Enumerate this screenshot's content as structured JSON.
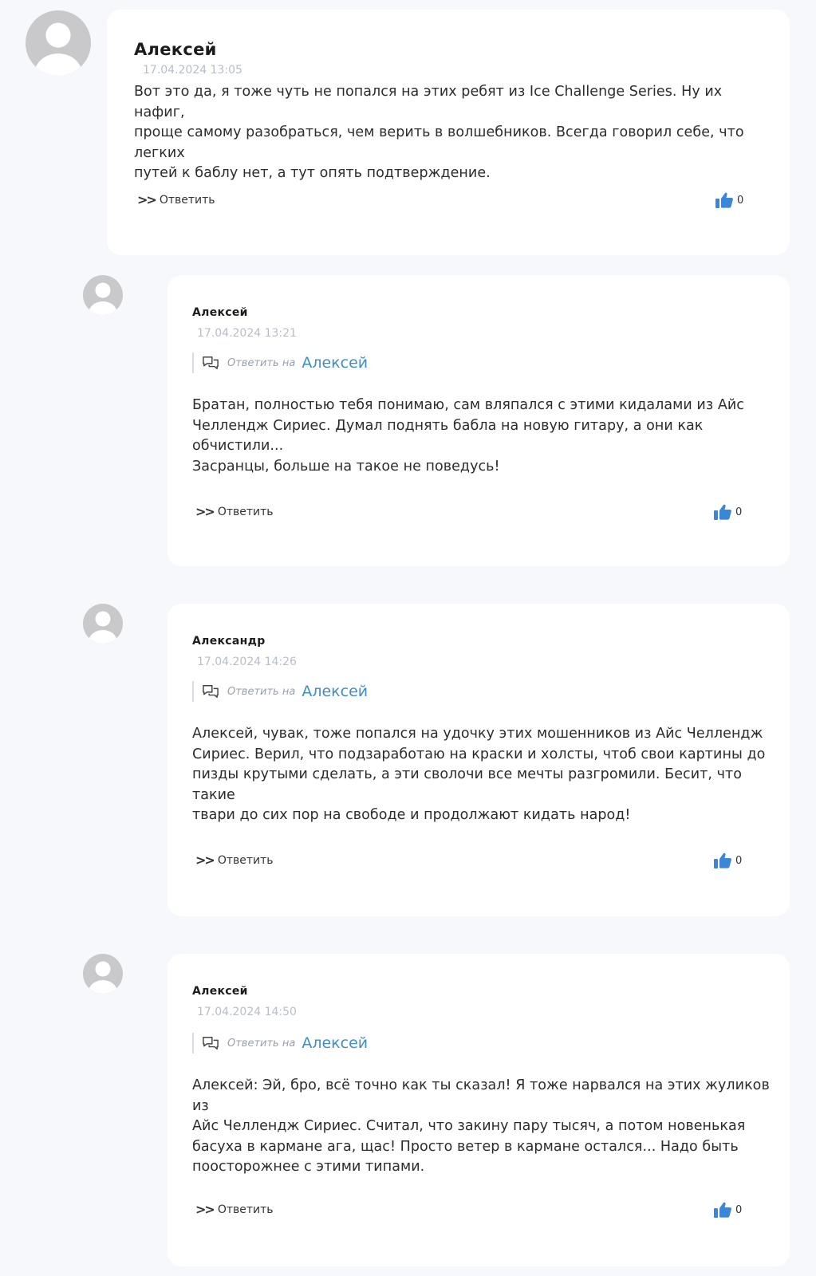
{
  "comments": [
    {
      "author": "Алексей",
      "date": "17.04.2024 13:05",
      "text_lines": [
        "Вот это да, я тоже чуть не попался на этих ребят из Ice Challenge Series. Ну их нафиг,",
        "проще самому разобраться, чем верить в волшебников. Всегда говорил себе, что легких",
        "путей к баблу нет, а тут опять подтверждение."
      ],
      "reply_label": "Ответить",
      "likes": "0"
    },
    {
      "author": "Алексей",
      "date": "17.04.2024 13:21",
      "reply_prefix": "Ответить на",
      "reply_target": "Алексей",
      "text_lines": [
        "Братан, полностью тебя понимаю, сам вляпался с этими кидалами из Айс",
        "Челлендж Сириес. Думал поднять бабла на новую гитару, а они как обчистили...",
        "Засранцы, больше на такое не поведусь!"
      ],
      "reply_label": "Ответить",
      "likes": "0"
    },
    {
      "author": "Александр",
      "date": "17.04.2024 14:26",
      "reply_prefix": "Ответить на",
      "reply_target": "Алексей",
      "text_lines": [
        "Алексей, чувак, тоже попался на удочку этих мошенников из Айс Челлендж",
        "Сириес. Верил, что подзаработаю на краски и холсты, чтоб свои картины до",
        "пизды крутыми сделать, а эти сволочи все мечты разгромили. Бесит, что такие",
        "твари до сих пор на свободе и продолжают кидать народ!"
      ],
      "reply_label": "Ответить",
      "likes": "0"
    },
    {
      "author": "Алексей",
      "date": "17.04.2024 14:50",
      "reply_prefix": "Ответить на",
      "reply_target": "Алексей",
      "text_lines": [
        "Алексей: Эй, бро, всё точно как ты сказал! Я тоже нарвался на этих жуликов из",
        "Айс Челлендж Сириес. Считал, что закину пару тысяч, а потом новенькая",
        "басуха в кармане ага, щас! Просто ветер в кармане остался... Надо быть",
        "поосторожнее с этими типами."
      ],
      "reply_label": "Ответить",
      "likes": "0"
    }
  ],
  "icons": {
    "avatar": "user-silhouette-icon",
    "reply_arrow": "double-chevron-right-icon",
    "reply_to": "speech-bubbles-icon",
    "like": "thumbs-up-icon"
  },
  "colors": {
    "page_bg": "#f6f8fc",
    "card_bg": "#ffffff",
    "link": "#3f8ec4",
    "like_icon": "#3b86d6",
    "date": "#b8bec8",
    "avatar": "#c9c9cc"
  }
}
